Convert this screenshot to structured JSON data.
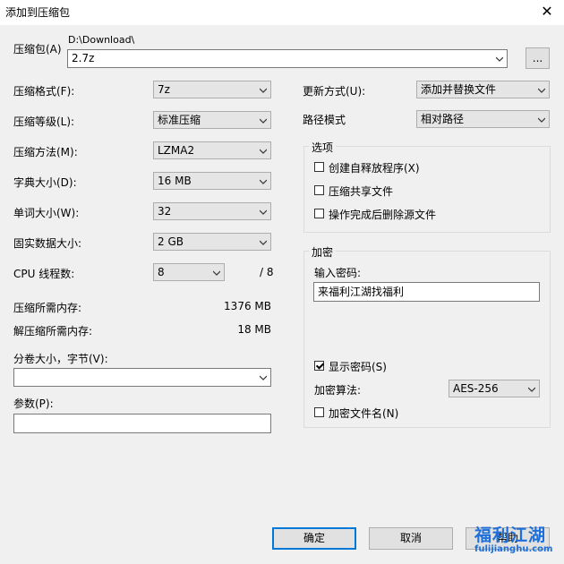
{
  "window": {
    "title": "添加到压缩包",
    "close_glyph": "✕"
  },
  "archive": {
    "label": "压缩包(A)",
    "path": "D:\\Download\\",
    "name": "2.7z",
    "browse_label": "..."
  },
  "left": {
    "format": {
      "label": "压缩格式(F):",
      "value": "7z"
    },
    "level": {
      "label": "压缩等级(L):",
      "value": "标准压缩"
    },
    "method": {
      "label": "压缩方法(M):",
      "value": "LZMA2"
    },
    "dict": {
      "label": "字典大小(D):",
      "value": "16 MB"
    },
    "word": {
      "label": "单词大小(W):",
      "value": "32"
    },
    "solid": {
      "label": "固实数据大小:",
      "value": "2 GB"
    },
    "threads": {
      "label": "CPU 线程数:",
      "value": "8",
      "max": "/ 8"
    },
    "mem_compress": {
      "label": "压缩所需内存:",
      "value": "1376 MB"
    },
    "mem_decompress": {
      "label": "解压缩所需内存:",
      "value": "18 MB"
    },
    "volume": {
      "label": "分卷大小，字节(V):",
      "value": ""
    },
    "params": {
      "label": "参数(P):",
      "value": ""
    }
  },
  "right": {
    "update": {
      "label": "更新方式(U):",
      "value": "添加并替换文件"
    },
    "pathmode": {
      "label": "路径模式",
      "value": "相对路径"
    },
    "options": {
      "title": "选项",
      "sfx": "创建自释放程序(X)",
      "shared": "压缩共享文件",
      "delete": "操作完成后删除源文件"
    },
    "encrypt": {
      "title": "加密",
      "pw_label": "输入密码:",
      "pw_value": "来福利江湖找福利",
      "show_pw": "显示密码(S)",
      "algo_label": "加密算法:",
      "algo_value": "AES-256",
      "enc_names": "加密文件名(N)"
    }
  },
  "buttons": {
    "ok": "确定",
    "cancel": "取消",
    "help": "帮助"
  },
  "watermark": {
    "brand": "福利江湖",
    "domain": "fulijianghu.com"
  }
}
